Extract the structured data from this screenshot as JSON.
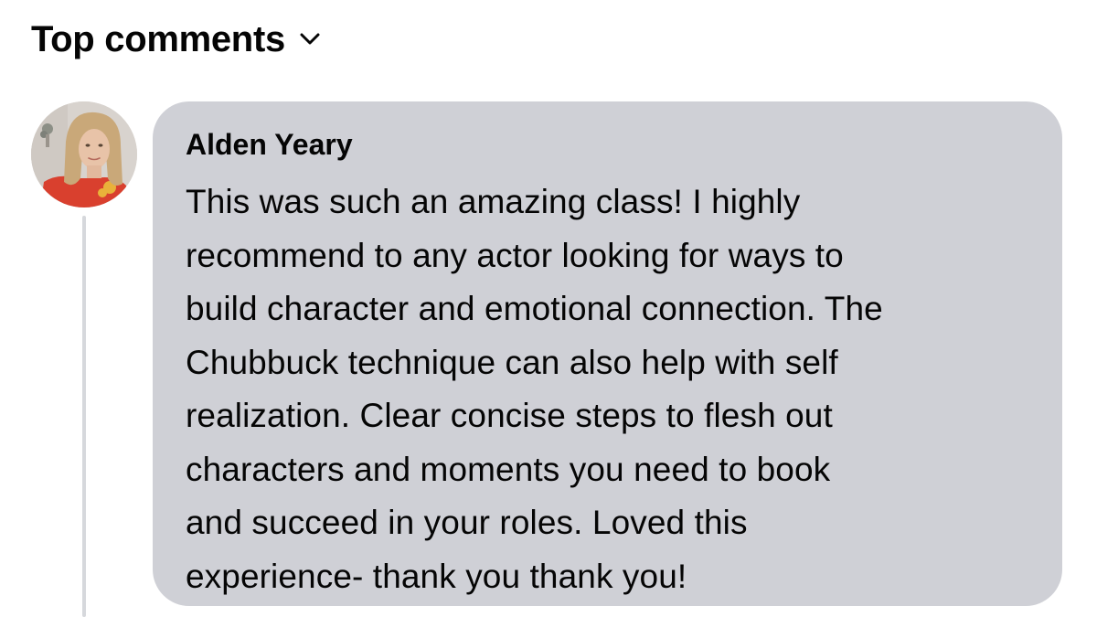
{
  "section": {
    "sort_label": "Top comments",
    "sort_icon": "chevron-down-icon"
  },
  "comment": {
    "avatar_icon": "user-avatar",
    "author": "Alden Yeary",
    "lines": [
      "This was such an amazing class! I highly",
      "recommend to any actor looking for ways to",
      "build character and emotional connection. The",
      "Chubbuck technique can also help with self",
      "realization. Clear concise steps to flesh out",
      "characters and moments you need to book",
      "and succeed in your roles. Loved this",
      "experience- thank you thank you!"
    ]
  },
  "colors": {
    "bubble": "#cfd0d6",
    "thread_line": "#d6d8dc",
    "text": "#050505"
  }
}
